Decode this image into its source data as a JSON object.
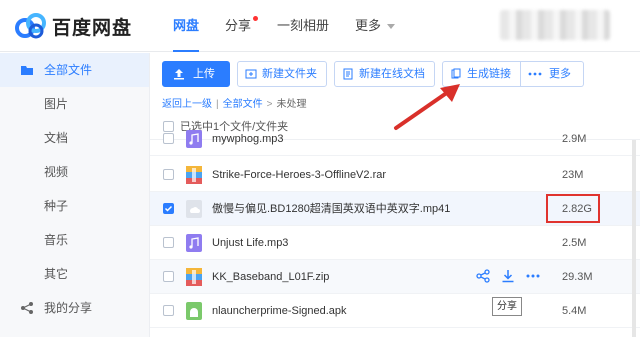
{
  "app": {
    "logo_text": "百度网盘"
  },
  "nav": [
    {
      "label": "网盘",
      "active": true
    },
    {
      "label": "分享",
      "dot": true
    },
    {
      "label": "一刻相册"
    },
    {
      "label": "更多",
      "caret": true
    }
  ],
  "sidebar": {
    "items": [
      {
        "label": "全部文件",
        "icon": "folder-icon",
        "active": true
      },
      {
        "label": "图片"
      },
      {
        "label": "文档"
      },
      {
        "label": "视频"
      },
      {
        "label": "种子"
      },
      {
        "label": "音乐"
      },
      {
        "label": "其它"
      },
      {
        "label": "我的分享",
        "icon": "share-icon"
      }
    ]
  },
  "toolbar": {
    "upload": "上传",
    "new_folder": "新建文件夹",
    "new_doc": "新建在线文档",
    "share_link": "生成链接",
    "more": "更多"
  },
  "breadcrumb": {
    "back": "返回上一级",
    "all": "全部文件",
    "current": "未处理"
  },
  "selection": {
    "text": "已选中1个文件/文件夹"
  },
  "files": [
    {
      "name": "mywphog.mp3",
      "size": "2.9M",
      "type": "audio"
    },
    {
      "name": "Strike-Force-Heroes-3-OfflineV2.rar",
      "size": "23M",
      "type": "archive"
    },
    {
      "name": "傲慢与偏见.BD1280超清国英双语中英双字.mp41",
      "size": "2.82G",
      "type": "unknown",
      "selected": true
    },
    {
      "name": "Unjust Life.mp3",
      "size": "2.5M",
      "type": "audio"
    },
    {
      "name": "KK_Baseband_L01F.zip",
      "size": "29.3M",
      "type": "archive"
    },
    {
      "name": "nlauncherprime-Signed.apk",
      "size": "5.4M",
      "type": "apk"
    }
  ],
  "tooltip": {
    "text": "分享"
  },
  "colors": {
    "accent": "#2b7dff",
    "highlight": "#e0332e"
  }
}
